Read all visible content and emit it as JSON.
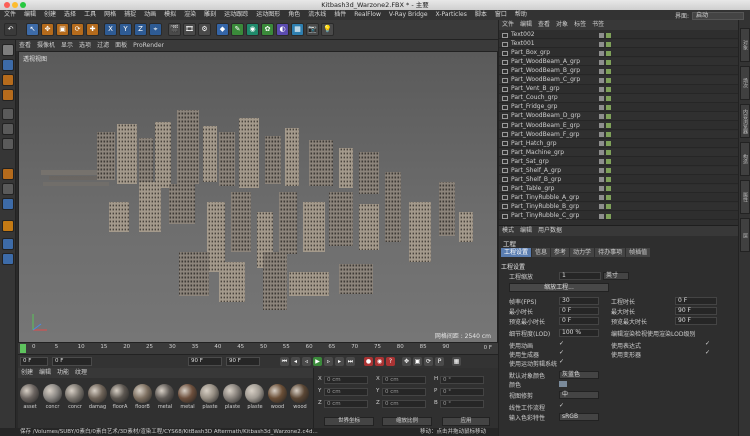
{
  "window": {
    "title": "Kitbash3d_Warzone2.FBX * - 主要"
  },
  "menubar": {
    "items": [
      "文件",
      "编辑",
      "创建",
      "选择",
      "工具",
      "网格",
      "捕捉",
      "动画",
      "模拟",
      "渲染",
      "雕刻",
      "运动跟踪",
      "运动图形",
      "角色",
      "流水线",
      "插件",
      "RealFlow",
      "V-Ray Bridge",
      "X-Particles",
      "脚本",
      "窗口",
      "帮助"
    ],
    "layout_label": "界面:",
    "layout_value": "启动"
  },
  "viewport": {
    "menu": [
      "查看",
      "摄像机",
      "显示",
      "选项",
      "过滤",
      "面板",
      "ProRender"
    ],
    "label": "透视视图",
    "grid_readout": "网格间距 : 2540 cm"
  },
  "timeline": {
    "ticks": [
      "0",
      "5",
      "10",
      "15",
      "20",
      "25",
      "30",
      "35",
      "40",
      "45",
      "50",
      "55",
      "60",
      "65",
      "70",
      "75",
      "80",
      "85",
      "90"
    ],
    "end_frame": "0 F",
    "current_frame": "0 F",
    "start_field": "0 F",
    "end_field": "90 F",
    "max_field": "90 F"
  },
  "materials": {
    "menu": [
      "创建",
      "编辑",
      "功能",
      "纹理"
    ],
    "items": [
      {
        "label": "asset",
        "color": "#6b6460"
      },
      {
        "label": "concr",
        "color": "#8a8783"
      },
      {
        "label": "concr",
        "color": "#7a756e"
      },
      {
        "label": "damag",
        "color": "#6e6358"
      },
      {
        "label": "floorA",
        "color": "#5c5650"
      },
      {
        "label": "floorB",
        "color": "#7d6f60"
      },
      {
        "label": "metal",
        "color": "#5f5a56"
      },
      {
        "label": "metal",
        "color": "#6d4f3c"
      },
      {
        "label": "plaste",
        "color": "#958d82"
      },
      {
        "label": "plaste",
        "color": "#86807a"
      },
      {
        "label": "plaste",
        "color": "#a09a92"
      },
      {
        "label": "wood",
        "color": "#6a4e36"
      },
      {
        "label": "wood",
        "color": "#5a4634"
      }
    ]
  },
  "coords": {
    "rows": [
      {
        "a": "X",
        "v1": "0 cm",
        "b": "X",
        "v2": "0 cm",
        "c": "H",
        "v3": "0 °"
      },
      {
        "a": "Y",
        "v1": "0 cm",
        "b": "Y",
        "v2": "0 cm",
        "c": "P",
        "v3": "0 °"
      },
      {
        "a": "Z",
        "v1": "0 cm",
        "b": "Z",
        "v2": "0 cm",
        "c": "B",
        "v3": "0 °"
      }
    ],
    "mode1": "世界坐标",
    "mode2": "缩放比例",
    "apply": "应用"
  },
  "status": {
    "text": "保存 /Volumes/SUBY/0素白/0素白艺术/3D素材/渲染工程/CYS68/KitBash3D Aftermath/Kitbash3d_Warzone2.c4d...",
    "hint": "移动：点击并拖动鼠标移动"
  },
  "objects": {
    "menu": [
      "文件",
      "编辑",
      "查看",
      "对象",
      "标签",
      "书签"
    ],
    "items": [
      "Text002",
      "Text001",
      "Part_Box_grp",
      "Part_WoodBeam_A_grp",
      "Part_WoodBeam_B_grp",
      "Part_WoodBeam_C_grp",
      "Part_Vent_B_grp",
      "Part_Couch_grp",
      "Part_Fridge_grp",
      "Part_WoodBeam_D_grp",
      "Part_WoodBeam_E_grp",
      "Part_WoodBeam_F_grp",
      "Part_Hatch_grp",
      "Part_Machine_grp",
      "Part_Sat_grp",
      "Part_Shelf_A_grp",
      "Part_Shelf_B_grp",
      "Part_Table_grp",
      "Part_TinyRubble_A_grp",
      "Part_TinyRubble_B_grp",
      "Part_TinyRubble_C_grp"
    ]
  },
  "attributes": {
    "menu": [
      "模式",
      "编辑",
      "用户数据"
    ],
    "title": "工程",
    "tabs": [
      "工程设置",
      "信息",
      "参考",
      "动力学",
      "待办事项",
      "帧插值"
    ],
    "section": "工程设置",
    "scale_label": "工程缩放",
    "scale_value": "1",
    "scale_unit": "英寸",
    "scale_button": "缩放工程...",
    "fps_label": "帧率(FPS)",
    "fps_value": "30",
    "duration_label": "工程时长",
    "duration_value": "0 F",
    "min_label": "最小时长",
    "min_value": "0 F",
    "max_label": "最大时长",
    "max_value": "90 F",
    "pmin_label": "预览最小时长",
    "pmin_value": "0 F",
    "pmax_label": "预览最大时长",
    "pmax_value": "90 F",
    "lod_label": "细节程度(LOD)",
    "lod_value": "100 %",
    "render_lod_label": "编辑渲染检视使用渲染LOD级别",
    "anim_label": "使用动画",
    "expr_label": "使用表达式",
    "gen_label": "使用生成器",
    "deform_label": "使用变形器",
    "motion_label": "使用运动剪辑系统",
    "defcolor_label": "默认对象颜色",
    "defcolor_value": "灰蓝色",
    "color_label": "颜色",
    "view_label": "视图修剪",
    "view_value": "中",
    "linear_label": "线性工作流程",
    "input_label": "输入色彩特性",
    "input_value": "sRGB"
  },
  "side_tabs": [
    "对象",
    "场次",
    "内容浏览器",
    "构造",
    "属性",
    "层"
  ]
}
